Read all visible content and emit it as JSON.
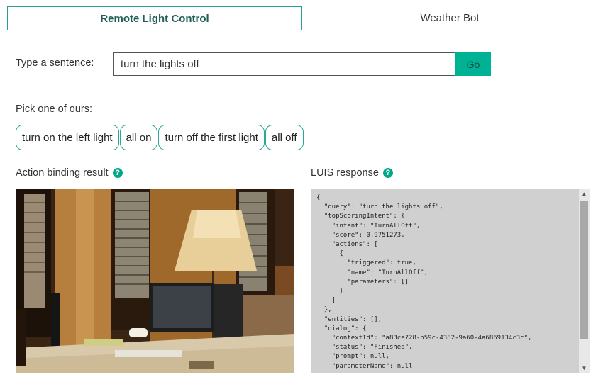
{
  "tabs": [
    {
      "label": "Remote Light Control",
      "active": true
    },
    {
      "label": "Weather Bot",
      "active": false
    }
  ],
  "sentence": {
    "label": "Type a sentence:",
    "value": "turn the lights off",
    "go_label": "Go"
  },
  "pick": {
    "label": "Pick one of ours:",
    "options": [
      "turn on the left light",
      "all on",
      "turn off the first light",
      "all off"
    ]
  },
  "action_binding": {
    "title": "Action binding result",
    "help_icon": "help-icon"
  },
  "luis": {
    "title": "LUIS response",
    "help_icon": "help-icon",
    "json_lines": [
      "{",
      "  \"query\": \"turn the lights off\",",
      "  \"topScoringIntent\": {",
      "    \"intent\": \"TurnAllOff\",",
      "    \"score\": 0.9751273,",
      "    \"actions\": [",
      "      {",
      "        \"triggered\": true,",
      "        \"name\": \"TurnAllOff\",",
      "        \"parameters\": []",
      "      }",
      "    ]",
      "  },",
      "  \"entities\": [],",
      "  \"dialog\": {",
      "    \"contextId\": \"a83ce728-b59c-4382-9a60-4a6869134c3c\",",
      "    \"status\": \"Finished\",",
      "    \"prompt\": null,",
      "    \"parameterName\": null"
    ]
  },
  "colors": {
    "accent": "#00b294",
    "tab_border": "#2a9d8f",
    "json_bg": "#d0d0d0"
  }
}
